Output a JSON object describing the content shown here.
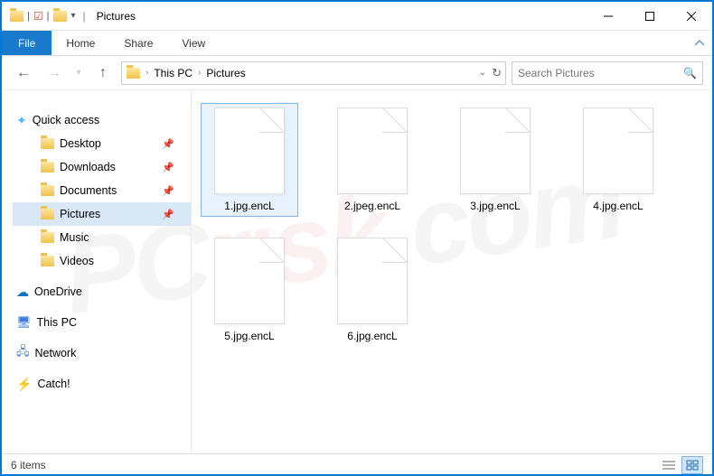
{
  "window": {
    "title": "Pictures"
  },
  "ribbon": {
    "file": "File",
    "tabs": [
      "Home",
      "Share",
      "View"
    ]
  },
  "breadcrumbs": [
    "This PC",
    "Pictures"
  ],
  "search": {
    "placeholder": "Search Pictures"
  },
  "sidebar": {
    "quick_access": "Quick access",
    "items": [
      {
        "label": "Desktop",
        "pinned": true
      },
      {
        "label": "Downloads",
        "pinned": true
      },
      {
        "label": "Documents",
        "pinned": true
      },
      {
        "label": "Pictures",
        "pinned": true,
        "selected": true
      },
      {
        "label": "Music",
        "pinned": false
      },
      {
        "label": "Videos",
        "pinned": false
      }
    ],
    "onedrive": "OneDrive",
    "thispc": "This PC",
    "network": "Network",
    "catch": "Catch!"
  },
  "files": [
    {
      "name": "1.jpg.encL",
      "selected": true
    },
    {
      "name": "2.jpeg.encL"
    },
    {
      "name": "3.jpg.encL"
    },
    {
      "name": "4.jpg.encL"
    },
    {
      "name": "5.jpg.encL"
    },
    {
      "name": "6.jpg.encL"
    }
  ],
  "status": {
    "count": "6 items"
  },
  "watermark": {
    "a": "PC",
    "b": "risk",
    "c": ".com"
  }
}
